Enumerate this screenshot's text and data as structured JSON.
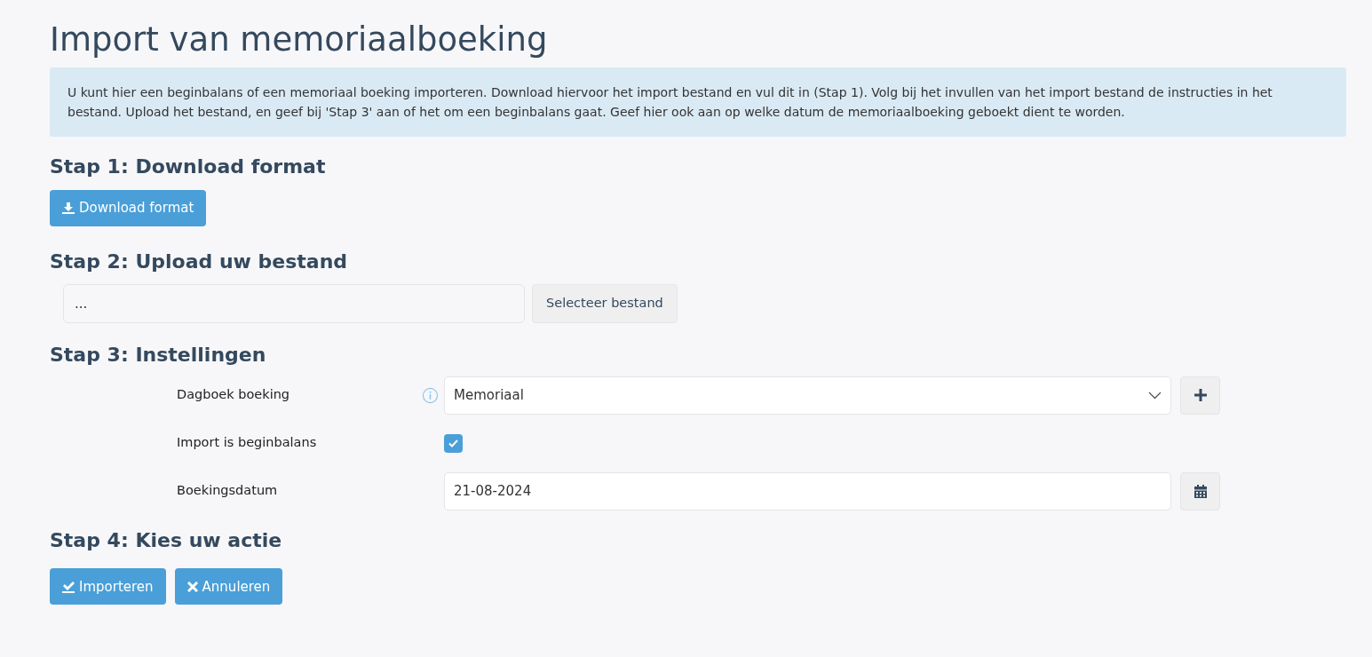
{
  "title": "Import van memoriaalboeking",
  "info": "U kunt hier een beginbalans of een memoriaal boeking importeren. Download hiervoor het import bestand en vul dit in (Stap 1). Volg bij het invullen van het import bestand de instructies in het bestand. Upload het bestand, en geef bij 'Stap 3' aan of het om een beginbalans gaat. Geef hier ook aan op welke datum de memoriaalboeking geboekt dient te worden.",
  "step1": {
    "heading": "Stap 1: Download format",
    "button": "Download format"
  },
  "step2": {
    "heading": "Stap 2: Upload uw bestand",
    "file_field": {
      "value": "..."
    },
    "select_button": "Selecteer bestand"
  },
  "step3": {
    "heading": "Stap 3: Instellingen",
    "fields": [
      {
        "kind": "select",
        "label": "Dagboek boeking",
        "info": true,
        "value": "Memoriaal"
      },
      {
        "kind": "checkbox",
        "label": "Import is beginbalans",
        "checked": true
      },
      {
        "kind": "date",
        "label": "Boekingsdatum",
        "value": "21-08-2024"
      }
    ]
  },
  "step4": {
    "heading": "Stap 4: Kies uw actie",
    "buttons": [
      {
        "kind": "import",
        "label": "Importeren"
      },
      {
        "kind": "cancel",
        "label": "Annuleren"
      }
    ]
  }
}
